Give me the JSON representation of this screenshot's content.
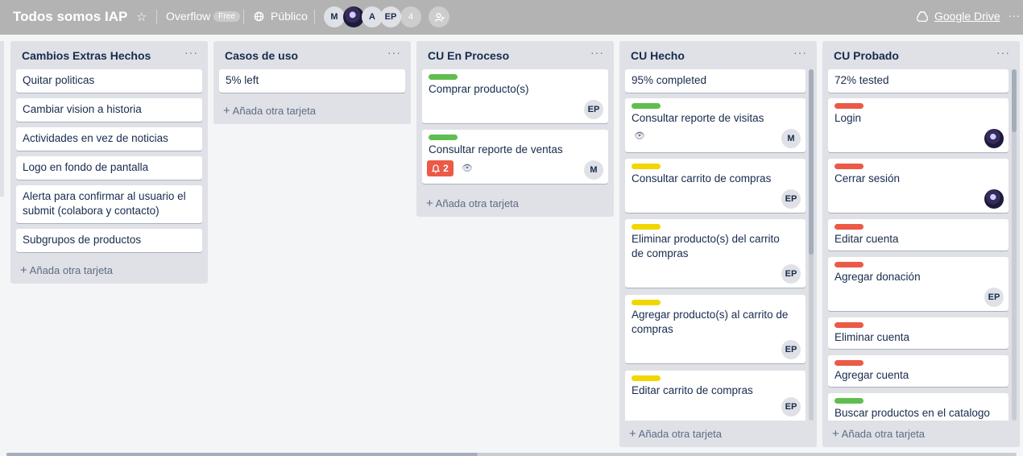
{
  "header": {
    "board_title": "Todos somos IAP",
    "team_name": "Overflow",
    "plan_badge": "Free",
    "visibility": "Público",
    "members": [
      "M",
      "",
      "A",
      "EP"
    ],
    "member_extra_count": "4",
    "drive_link": "Google Drive",
    "menu": "···"
  },
  "lists": [
    {
      "title": "Cambios Extras Hechos",
      "menu": "···",
      "cards": [
        {
          "text": "Quitar politicas"
        },
        {
          "text": "Cambiar vision a historia"
        },
        {
          "text": "Actividades en vez de noticias"
        },
        {
          "text": "Logo en fondo de pantalla"
        },
        {
          "text": "Alerta para confirmar al usuario el submit (colabora y contacto)"
        },
        {
          "text": "Subgrupos de productos"
        }
      ],
      "add": "Añada otra tarjeta"
    },
    {
      "title": "Casos de uso",
      "menu": "···",
      "cards": [
        {
          "text": "5% left"
        }
      ],
      "add": "Añada otra tarjeta"
    },
    {
      "title": "CU En Proceso",
      "menu": "···",
      "cards": [
        {
          "text": "Comprar producto(s)",
          "label": "green",
          "avatar": "EP"
        },
        {
          "text": "Consultar reporte de ventas",
          "label": "green",
          "avatar": "M",
          "notifications": "2"
        }
      ],
      "add": "Añada otra tarjeta"
    },
    {
      "title": "CU Hecho",
      "menu": "···",
      "cards": [
        {
          "text": "95% completed"
        },
        {
          "text": "Consultar reporte de visitas",
          "label": "green",
          "avatar": "M"
        },
        {
          "text": "Consultar carrito de compras",
          "label": "yellow",
          "avatar": "EP"
        },
        {
          "text": "Eliminar producto(s) del carrito de compras",
          "label": "yellow",
          "avatar": "EP"
        },
        {
          "text": "Agregar producto(s) al carrito de compras",
          "label": "yellow",
          "avatar": "EP"
        },
        {
          "text": "Editar carrito de compras",
          "label": "yellow",
          "avatar": "EP"
        }
      ],
      "add": "Añada otra tarjeta"
    },
    {
      "title": "CU Probado",
      "menu": "···",
      "cards": [
        {
          "text": "72% tested"
        },
        {
          "text": "Login",
          "label": "red"
        },
        {
          "text": "Cerrar sesión",
          "label": "red"
        },
        {
          "text": "Editar cuenta",
          "label": "red"
        },
        {
          "text": "Agregar donación",
          "label": "red",
          "avatar": "EP"
        },
        {
          "text": "Eliminar cuenta",
          "label": "red"
        },
        {
          "text": "Agregar cuenta",
          "label": "red"
        },
        {
          "text": "Buscar productos en el catalogo",
          "label": "green"
        }
      ],
      "add": "Añada otra tarjeta"
    }
  ],
  "colors": {
    "green": "#61bd4f",
    "yellow": "#f2d600",
    "red": "#eb5a46",
    "header_bg": "#b3b3b3",
    "board_bg": "#f4f5f7",
    "list_bg": "#dfe1e6"
  }
}
